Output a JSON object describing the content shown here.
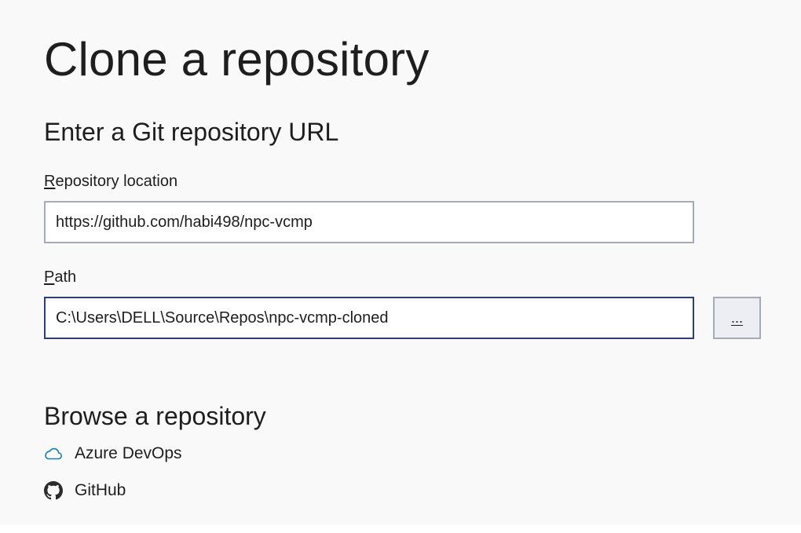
{
  "page": {
    "title": "Clone a repository"
  },
  "git_url_section": {
    "heading": "Enter a Git repository URL",
    "repository_location": {
      "label_mnemonic": "R",
      "label_rest": "epository location",
      "value": "https://github.com/habi498/npc-vcmp"
    },
    "path": {
      "label_mnemonic": "P",
      "label_rest": "ath",
      "value": "C:\\Users\\DELL\\Source\\Repos\\npc-vcmp-cloned"
    },
    "browse_button_label": "..."
  },
  "browse_section": {
    "heading": "Browse a repository",
    "providers": [
      {
        "label": "Azure DevOps",
        "icon": "azure-cloud-icon",
        "color": "#1b7bb7"
      },
      {
        "label": "GitHub",
        "icon": "github-icon",
        "color": "#2b2b2b"
      }
    ]
  },
  "colors": {
    "background": "#f9f9f9",
    "text": "#1e1e1e",
    "input_border": "#a6aab5",
    "input_focus_border": "#2b3f74",
    "button_background": "#eceef4"
  }
}
